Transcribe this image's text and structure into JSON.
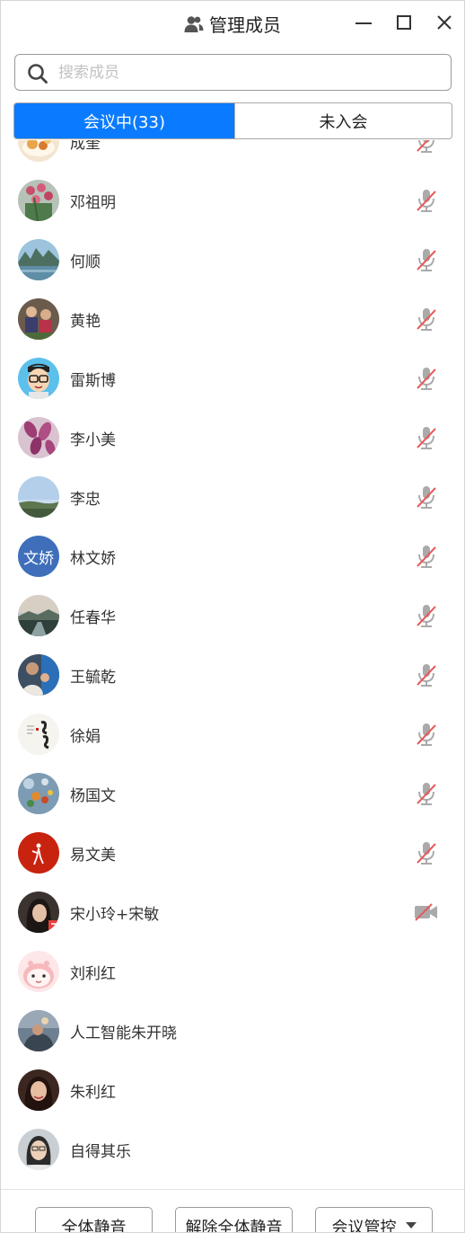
{
  "window": {
    "title": "管理成员",
    "icon": "people-icon"
  },
  "window_controls": [
    "minimize-icon",
    "maximize-icon",
    "close-icon"
  ],
  "search": {
    "placeholder": "搜索成员",
    "value": ""
  },
  "tabs": [
    {
      "label": "会议中(33)",
      "active": true
    },
    {
      "label": "未入会",
      "active": false
    }
  ],
  "colors": {
    "accent": "#0a7bff",
    "muted_slash": "#e85a5a",
    "icon_gray": "#9a9a9a"
  },
  "members": [
    {
      "name": "成奎",
      "status": "mic-muted-icon",
      "avatar": "photo-food"
    },
    {
      "name": "邓祖明",
      "status": "mic-muted-icon",
      "avatar": "photo-flowers"
    },
    {
      "name": "何顺",
      "status": "mic-muted-icon",
      "avatar": "photo-mountains"
    },
    {
      "name": "黄艳",
      "status": "mic-muted-icon",
      "avatar": "photo-people"
    },
    {
      "name": "雷斯博",
      "status": "mic-muted-icon",
      "avatar": "cartoon-glasses"
    },
    {
      "name": "李小美",
      "status": "mic-muted-icon",
      "avatar": "photo-pink-leaves"
    },
    {
      "name": "李忠",
      "status": "mic-muted-icon",
      "avatar": "photo-sky"
    },
    {
      "name": "林文娇",
      "status": "mic-muted-icon",
      "avatar_text": "文娇"
    },
    {
      "name": "任春华",
      "status": "mic-muted-icon",
      "avatar": "photo-lake"
    },
    {
      "name": "王毓乾",
      "status": "mic-muted-icon",
      "avatar": "photo-family"
    },
    {
      "name": "徐娟",
      "status": "mic-muted-icon",
      "avatar": "calligraphy"
    },
    {
      "name": "杨国文",
      "status": "mic-muted-icon",
      "avatar": "photo-bokeh"
    },
    {
      "name": "易文美",
      "status": "mic-muted-icon",
      "avatar": "red-figure"
    },
    {
      "name": "宋小玲+宋敏",
      "status": "camera-off-icon",
      "avatar": "photo-portrait"
    },
    {
      "name": "刘利红",
      "status": "none",
      "avatar": "cartoon-pink"
    },
    {
      "name": "人工智能朱开晓",
      "status": "none",
      "avatar": "photo-dusk"
    },
    {
      "name": "朱利红",
      "status": "none",
      "avatar": "photo-girl"
    },
    {
      "name": "自得其乐",
      "status": "none",
      "avatar": "photo-woman"
    }
  ],
  "footer": {
    "mute_all": "全体静音",
    "unmute_all": "解除全体静音",
    "meeting_control": "会议管控"
  }
}
